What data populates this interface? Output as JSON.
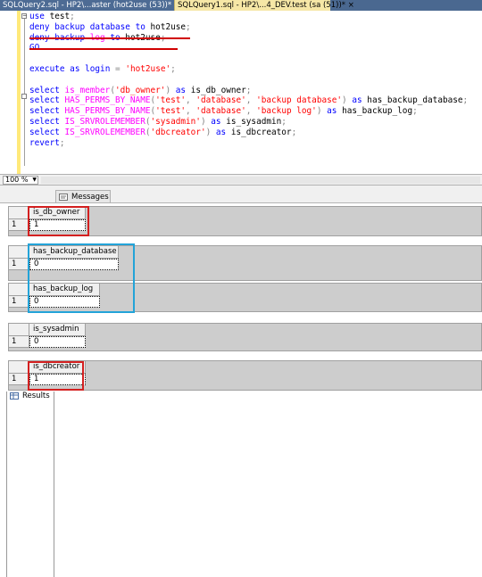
{
  "tabs": [
    {
      "label": "SQLQuery2.sql - HP2\\...aster (hot2use (53))*"
    },
    {
      "label": "SQLQuery1.sql - HP2\\...4_DEV.test (sa (51))*"
    }
  ],
  "tab_close_icon": "×",
  "editor": {
    "collapse_icon": "minus",
    "lines": [
      {
        "tokens": [
          [
            "kw",
            "use"
          ],
          [
            "txt",
            " test"
          ],
          [
            "gr",
            ";"
          ]
        ]
      },
      {
        "tokens": [
          [
            "kw",
            "deny"
          ],
          [
            "txt",
            " "
          ],
          [
            "kw",
            "backup"
          ],
          [
            "txt",
            " "
          ],
          [
            "kw",
            "database"
          ],
          [
            "txt",
            " "
          ],
          [
            "kw",
            "to"
          ],
          [
            "txt",
            " hot2use"
          ],
          [
            "gr",
            ";"
          ]
        ]
      },
      {
        "tokens": [
          [
            "kw",
            "deny"
          ],
          [
            "txt",
            " "
          ],
          [
            "kw",
            "backup"
          ],
          [
            "txt",
            " "
          ],
          [
            "fn",
            "log"
          ],
          [
            "txt",
            " "
          ],
          [
            "kw",
            "to"
          ],
          [
            "txt",
            " hot2use"
          ],
          [
            "gr",
            ";"
          ]
        ]
      },
      {
        "tokens": [
          [
            "kw",
            "GO"
          ]
        ]
      },
      {
        "tokens": []
      },
      {
        "tokens": [
          [
            "kw",
            "execute"
          ],
          [
            "txt",
            " "
          ],
          [
            "kw",
            "as"
          ],
          [
            "txt",
            " "
          ],
          [
            "kw",
            "login"
          ],
          [
            "txt",
            " "
          ],
          [
            "gr",
            "="
          ],
          [
            "txt",
            " "
          ],
          [
            "str",
            "'hot2use'"
          ],
          [
            "gr",
            ";"
          ]
        ]
      },
      {
        "tokens": []
      },
      {
        "tokens": [
          [
            "kw",
            "select"
          ],
          [
            "txt",
            " "
          ],
          [
            "fn",
            "is_member"
          ],
          [
            "gr",
            "("
          ],
          [
            "str",
            "'db_owner'"
          ],
          [
            "gr",
            ")"
          ],
          [
            "txt",
            " "
          ],
          [
            "kw",
            "as"
          ],
          [
            "txt",
            " is_db_owner"
          ],
          [
            "gr",
            ";"
          ]
        ]
      },
      {
        "tokens": [
          [
            "kw",
            "select"
          ],
          [
            "txt",
            " "
          ],
          [
            "fn",
            "HAS_PERMS_BY_NAME"
          ],
          [
            "gr",
            "("
          ],
          [
            "str",
            "'test'"
          ],
          [
            "gr",
            ","
          ],
          [
            "txt",
            " "
          ],
          [
            "str",
            "'database'"
          ],
          [
            "gr",
            ","
          ],
          [
            "txt",
            " "
          ],
          [
            "str",
            "'backup database'"
          ],
          [
            "gr",
            ")"
          ],
          [
            "txt",
            " "
          ],
          [
            "kw",
            "as"
          ],
          [
            "txt",
            " has_backup_database"
          ],
          [
            "gr",
            ";"
          ]
        ]
      },
      {
        "tokens": [
          [
            "kw",
            "select"
          ],
          [
            "txt",
            " "
          ],
          [
            "fn",
            "HAS_PERMS_BY_NAME"
          ],
          [
            "gr",
            "("
          ],
          [
            "str",
            "'test'"
          ],
          [
            "gr",
            ","
          ],
          [
            "txt",
            " "
          ],
          [
            "str",
            "'database'"
          ],
          [
            "gr",
            ","
          ],
          [
            "txt",
            " "
          ],
          [
            "str",
            "'backup log'"
          ],
          [
            "gr",
            ")"
          ],
          [
            "txt",
            " "
          ],
          [
            "kw",
            "as"
          ],
          [
            "txt",
            " has_backup_log"
          ],
          [
            "gr",
            ";"
          ]
        ]
      },
      {
        "tokens": [
          [
            "kw",
            "select"
          ],
          [
            "txt",
            " "
          ],
          [
            "fn",
            "IS_SRVROLEMEMBER"
          ],
          [
            "gr",
            "("
          ],
          [
            "str",
            "'sysadmin'"
          ],
          [
            "gr",
            ")"
          ],
          [
            "txt",
            " "
          ],
          [
            "kw",
            "as"
          ],
          [
            "txt",
            " is_sysadmin"
          ],
          [
            "gr",
            ";"
          ]
        ]
      },
      {
        "tokens": [
          [
            "kw",
            "select"
          ],
          [
            "txt",
            " "
          ],
          [
            "fn",
            "IS_SRVROLEMEMBER"
          ],
          [
            "gr",
            "("
          ],
          [
            "str",
            "'dbcreator'"
          ],
          [
            "gr",
            ")"
          ],
          [
            "txt",
            " "
          ],
          [
            "kw",
            "as"
          ],
          [
            "txt",
            " is_dbcreator"
          ],
          [
            "gr",
            ";"
          ]
        ]
      },
      {
        "tokens": [
          [
            "kw",
            "revert"
          ],
          [
            "gr",
            ";"
          ]
        ]
      }
    ]
  },
  "zoom": {
    "value": "100 %"
  },
  "result_tabs": {
    "results": "Results",
    "messages": "Messages"
  },
  "result_grids": [
    {
      "column": "is_db_owner",
      "row_number": "1",
      "value": "1"
    },
    {
      "column": "has_backup_database",
      "row_number": "1",
      "value": "0"
    },
    {
      "column": "has_backup_log",
      "row_number": "1",
      "value": "0"
    },
    {
      "column": "is_sysadmin",
      "row_number": "1",
      "value": "0"
    },
    {
      "column": "is_dbcreator",
      "row_number": "1",
      "value": "1"
    }
  ],
  "colors": {
    "annotation_red": "#d42020",
    "annotation_blue": "#23a3d8",
    "keyword": "#0000ff",
    "string": "#ff0000",
    "function": "#ff00ff"
  }
}
